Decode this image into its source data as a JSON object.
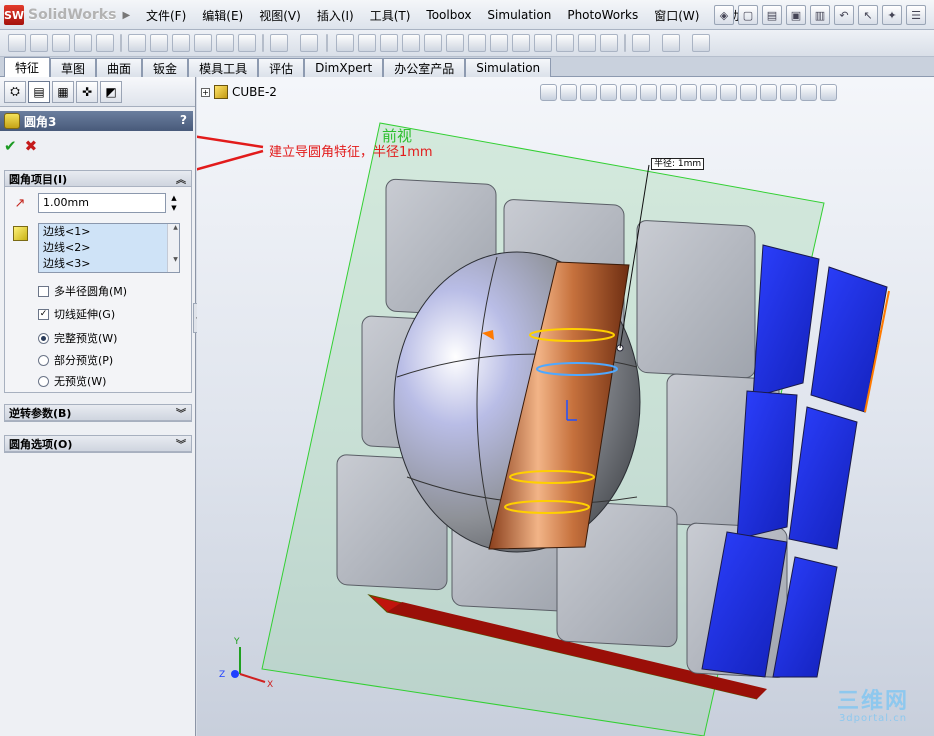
{
  "app": {
    "name": "SolidWorks",
    "logo_letters": "SW"
  },
  "menus": [
    "文件(F)",
    "编辑(E)",
    "视图(V)",
    "插入(I)",
    "工具(T)",
    "Toolbox",
    "Simulation",
    "PhotoWorks",
    "窗口(W)",
    "帮助(H)"
  ],
  "tabs": [
    {
      "label": "特征",
      "active": true
    },
    {
      "label": "草图"
    },
    {
      "label": "曲面"
    },
    {
      "label": "钣金"
    },
    {
      "label": "模具工具"
    },
    {
      "label": "评估"
    },
    {
      "label": "DimXpert"
    },
    {
      "label": "办公室产品"
    },
    {
      "label": "Simulation"
    }
  ],
  "property_manager": {
    "title": "圆角3",
    "help": "?",
    "group_items": {
      "title": "圆角项目(I)",
      "radius_value": "1.00mm",
      "edges": [
        "边线<1>",
        "边线<2>",
        "边线<3>"
      ],
      "multi_radius": "多半径圆角(M)",
      "tangent_propagation": "切线延伸(G)",
      "full_preview": "完整预览(W)",
      "partial_preview": "部分预览(P)",
      "no_preview": "无预览(W)"
    },
    "group_setback": {
      "title": "逆转参数(B)"
    },
    "group_options": {
      "title": "圆角选项(O)"
    }
  },
  "graphics": {
    "tree_item": "CUBE-2",
    "view_name": "前视",
    "radius_dimension": "半径: 1mm",
    "annotation": "建立导圆角特征，半径1mm",
    "watermark_big": "三维网",
    "watermark_small": "3dportal.cn",
    "colors": {
      "accent_red": "#e21b1b",
      "face_blue": "#1a2ff0",
      "face_red": "#c0140c",
      "cylinder_copper": "#c6713d",
      "plane_green": "#2fbf2f"
    }
  }
}
